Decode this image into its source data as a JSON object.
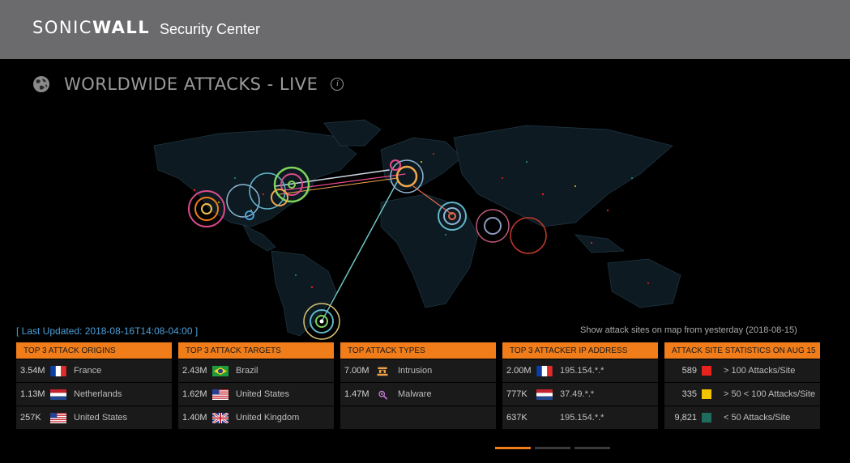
{
  "header": {
    "brand_light": "SONIC",
    "brand_bold": "WALL",
    "subtitle": "Security Center"
  },
  "page": {
    "title": "WORLDWIDE ATTACKS - LIVE",
    "info_glyph": "i",
    "last_updated": "[ Last Updated: 2018-08-16T14:08-04:00 ]",
    "show_yesterday": "Show attack sites on map from yesterday (2018-08-15)"
  },
  "panels": {
    "origins": {
      "title": "TOP 3 ATTACK ORIGINS",
      "rows": [
        {
          "value": "3.54M",
          "name": "France",
          "flag": "france-flag"
        },
        {
          "value": "1.13M",
          "name": "Netherlands",
          "flag": "netherlands-flag"
        },
        {
          "value": "257K",
          "name": "United States",
          "flag": "usa-flag"
        }
      ]
    },
    "targets": {
      "title": "TOP 3 ATTACK TARGETS",
      "rows": [
        {
          "value": "2.43M",
          "name": "Brazil",
          "flag": "brazil-flag"
        },
        {
          "value": "1.62M",
          "name": "United States",
          "flag": "usa-flag"
        },
        {
          "value": "1.40M",
          "name": "United Kingdom",
          "flag": "uk-flag"
        }
      ]
    },
    "types": {
      "title": "TOP ATTACK TYPES",
      "rows": [
        {
          "value": "7.00M",
          "name": "Intrusion",
          "icon": "intrusion-icon"
        },
        {
          "value": "1.47M",
          "name": "Malware",
          "icon": "malware-icon"
        }
      ]
    },
    "ips": {
      "title": "TOP 3 ATTACKER IP ADDRESS",
      "rows": [
        {
          "value": "2.00M",
          "name": "195.154.*.*",
          "flag": "france-flag"
        },
        {
          "value": "777K",
          "name": "37.49.*.*",
          "flag": "netherlands-flag"
        },
        {
          "value": "637K",
          "name": "195.154.*.*",
          "flag": "none"
        }
      ]
    },
    "stats": {
      "title": "ATTACK SITE STATISTICS ON AUG 15",
      "rows": [
        {
          "value": "589",
          "name": "> 100 Attacks/Site",
          "color": "#e8231e"
        },
        {
          "value": "335",
          "name": "> 50 < 100 Attacks/Site",
          "color": "#f3c400"
        },
        {
          "value": "9,821",
          "name": "< 50 Attacks/Site",
          "color": "#1f6b5e"
        }
      ]
    }
  },
  "colors": {
    "accent": "#f07d1a",
    "link": "#4a9fd8",
    "header_bg": "#6b6b6d"
  }
}
